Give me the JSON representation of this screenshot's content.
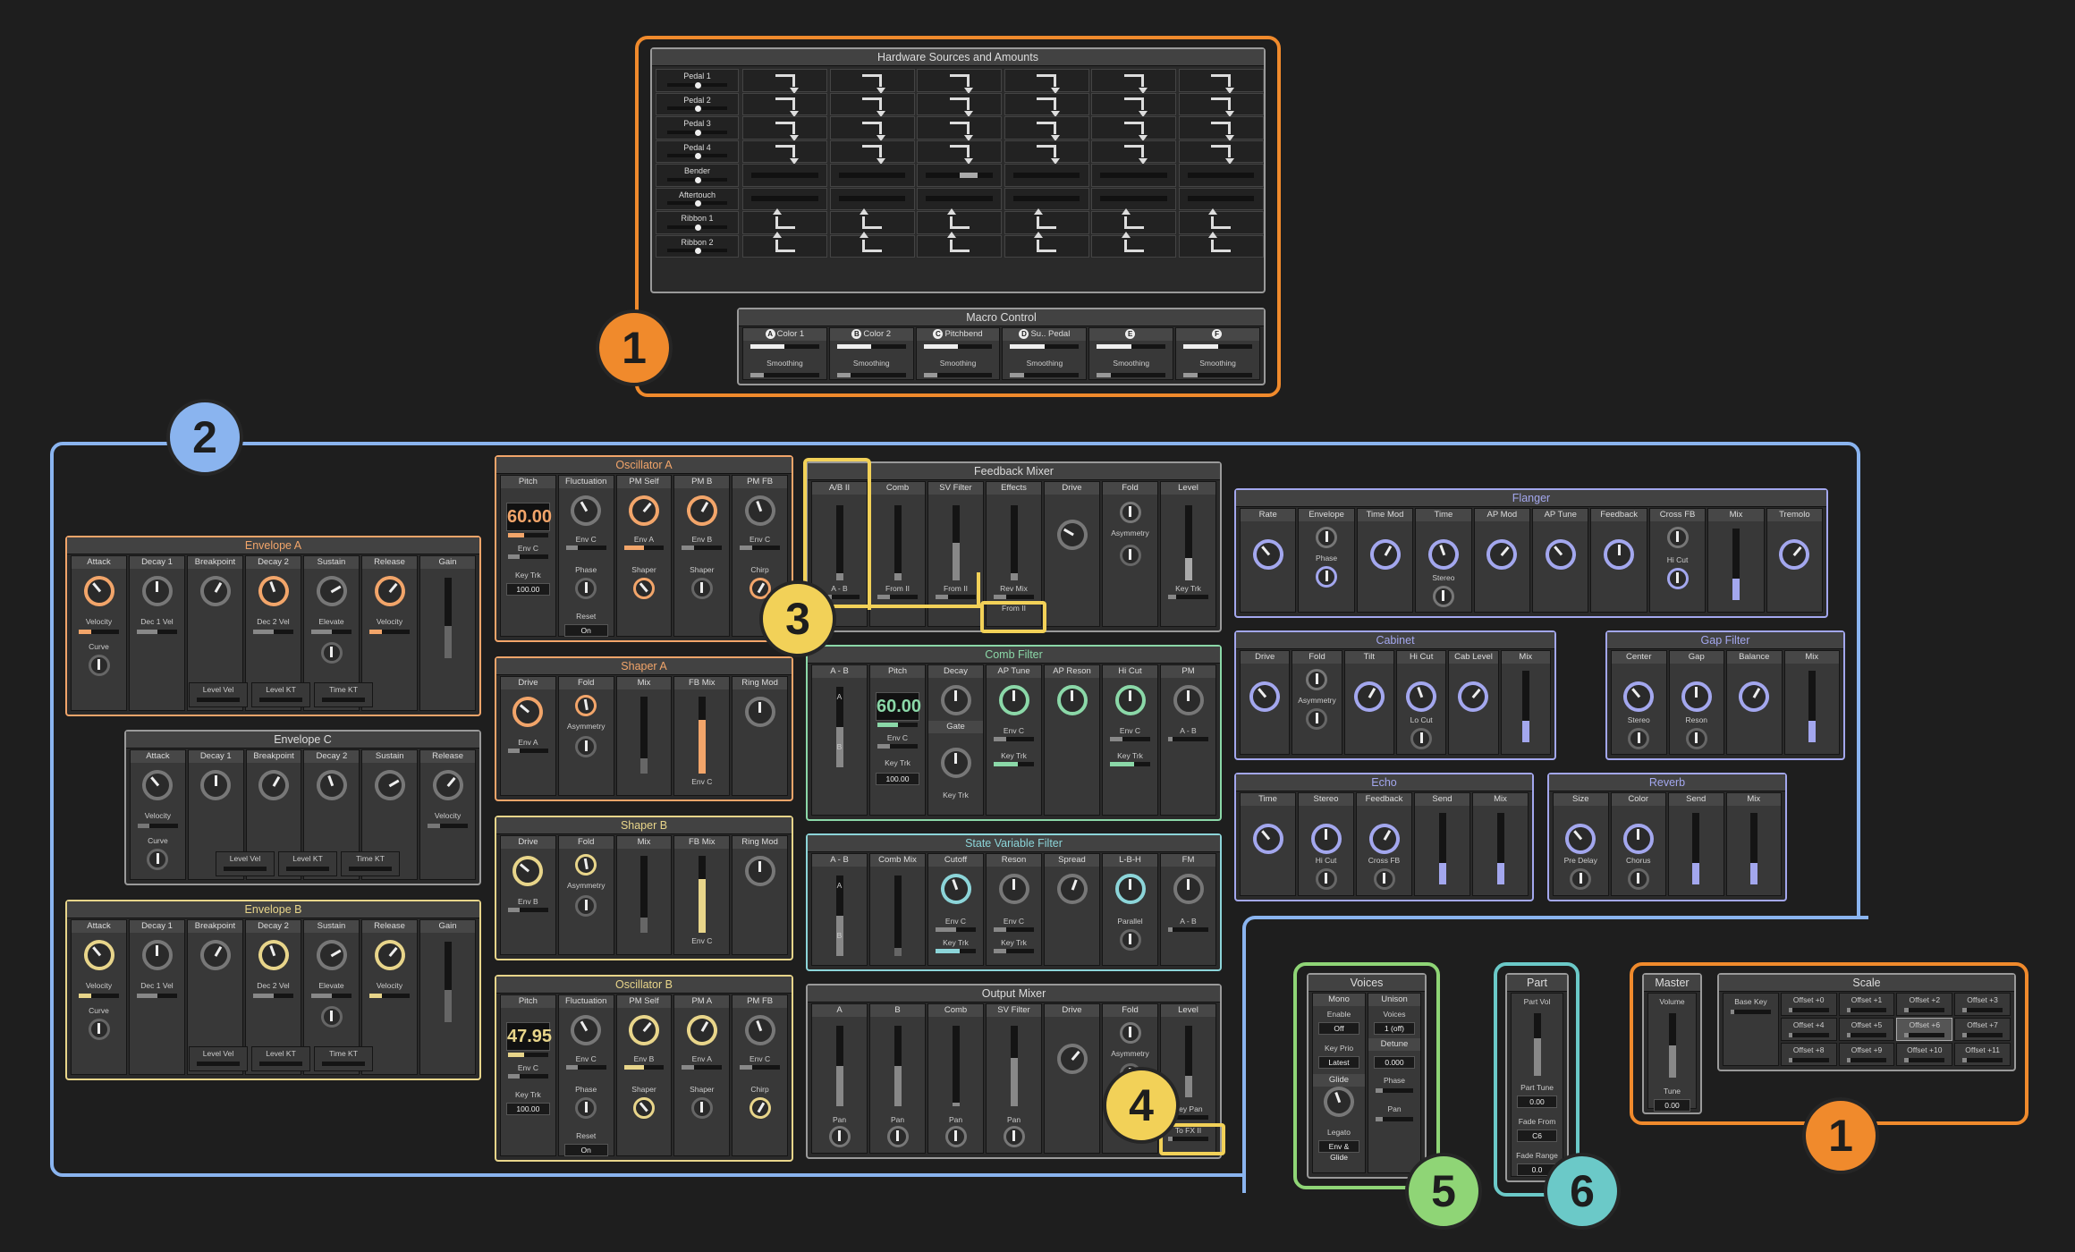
{
  "colors": {
    "orange": "#f08a2c",
    "blue": "#8ab4ef",
    "yellow": "#f2d158",
    "green": "#8fd576",
    "teal": "#6bc9c8",
    "env_a": "#f2a56a",
    "env_b": "#e8d58a",
    "comb": "#8bd8a8",
    "svf": "#8cd5d9",
    "fx": "#a3a7ee"
  },
  "badges": [
    "1",
    "2",
    "3",
    "4",
    "5",
    "1",
    "6"
  ],
  "hardware": {
    "title": "Hardware Sources and Amounts",
    "rows": [
      "Pedal 1",
      "Pedal 2",
      "Pedal 3",
      "Pedal 4",
      "Bender",
      "Aftertouch",
      "Ribbon 1",
      "Ribbon 2"
    ]
  },
  "macro": {
    "title": "Macro Control",
    "controls": [
      {
        "letter": "A",
        "name": "Color 1"
      },
      {
        "letter": "B",
        "name": "Color 2"
      },
      {
        "letter": "C",
        "name": "Pitchbend"
      },
      {
        "letter": "D",
        "name": "Su.. Pedal"
      },
      {
        "letter": "E",
        "name": ""
      },
      {
        "letter": "F",
        "name": ""
      }
    ],
    "smoothing": "Smoothing"
  },
  "env_a": {
    "title": "Envelope A",
    "cols": [
      "Attack",
      "Decay 1",
      "Breakpoint",
      "Decay 2",
      "Sustain",
      "Release",
      "Gain"
    ],
    "subs": [
      "Velocity",
      "Dec 1 Vel",
      "",
      "Dec 2 Vel",
      "Elevate",
      "Velocity"
    ],
    "curve": "Curve",
    "bottom": [
      "Level Vel",
      "Level KT",
      "Time KT"
    ]
  },
  "env_c": {
    "title": "Envelope C",
    "cols": [
      "Attack",
      "Decay 1",
      "Breakpoint",
      "Decay 2",
      "Sustain",
      "Release"
    ],
    "subs": [
      "Velocity",
      "",
      "",
      "",
      "",
      "Velocity"
    ],
    "curve": "Curve",
    "bottom": [
      "Level Vel",
      "Level KT",
      "Time KT"
    ]
  },
  "env_b": {
    "title": "Envelope B",
    "cols": [
      "Attack",
      "Decay 1",
      "Breakpoint",
      "Decay 2",
      "Sustain",
      "Release",
      "Gain"
    ],
    "subs": [
      "Velocity",
      "Dec 1 Vel",
      "",
      "Dec 2 Vel",
      "Elevate",
      "Velocity"
    ],
    "curve": "Curve",
    "bottom": [
      "Level Vel",
      "Level KT",
      "Time KT"
    ]
  },
  "osc_a": {
    "title": "Oscillator A",
    "cols": [
      "Pitch",
      "Fluctuation",
      "PM Self",
      "PM B",
      "PM FB"
    ],
    "pitch": "60.00",
    "subs": [
      "Env C",
      "Env C",
      "Env A",
      "Env B",
      "Env C"
    ],
    "keytrk": "Key Trk",
    "keytrk_val": "100.00",
    "phase": "Phase",
    "shaper": "Shaper",
    "chirp": "Chirp",
    "reset": "Reset",
    "reset_val": "On"
  },
  "shaper_a": {
    "title": "Shaper A",
    "cols": [
      "Drive",
      "Fold",
      "Mix",
      "FB Mix",
      "Ring Mod"
    ],
    "env": "Env A",
    "asym": "Asymmetry",
    "envc": "Env C"
  },
  "shaper_b": {
    "title": "Shaper B",
    "cols": [
      "Drive",
      "Fold",
      "Mix",
      "FB Mix",
      "Ring Mod"
    ],
    "env": "Env B",
    "asym": "Asymmetry",
    "envc": "Env C"
  },
  "osc_b": {
    "title": "Oscillator B",
    "cols": [
      "Pitch",
      "Fluctuation",
      "PM Self",
      "PM A",
      "PM FB"
    ],
    "pitch": "47.95",
    "subs": [
      "Env C",
      "Env C",
      "Env B",
      "Env A",
      "Env C"
    ],
    "keytrk": "Key Trk",
    "keytrk_val": "100.00",
    "phase": "Phase",
    "shaper": "Shaper",
    "chirp": "Chirp",
    "reset": "Reset",
    "reset_val": "On"
  },
  "fb_mixer": {
    "title": "Feedback Mixer",
    "cols": [
      "A/B II",
      "Comb",
      "SV Filter",
      "Effects",
      "Drive",
      "Fold",
      "Level"
    ],
    "subs": [
      "A - B",
      "From II",
      "From II",
      "Rev Mix"
    ],
    "from2": "From II",
    "asym": "Asymmetry",
    "keytrk": "Key Trk"
  },
  "comb": {
    "title": "Comb Filter",
    "cols": [
      "A - B",
      "Pitch",
      "Decay",
      "AP Tune",
      "AP Reson",
      "Hi Cut",
      "PM"
    ],
    "pitch": "60.00",
    "envc": "Env C",
    "keytrk": "Key Trk",
    "keytrk_val": "100.00",
    "gate": "Gate",
    "ab": "A - B",
    "a": "A",
    "b": "B"
  },
  "svf": {
    "title": "State Variable Filter",
    "cols": [
      "A - B",
      "Comb Mix",
      "Cutoff",
      "Reson",
      "Spread",
      "L-B-H",
      "FM"
    ],
    "envc": "Env C",
    "keytrk": "Key Trk",
    "parallel": "Parallel",
    "ab": "A - B",
    "a": "A",
    "b": "B"
  },
  "out_mixer": {
    "title": "Output Mixer",
    "cols": [
      "A",
      "B",
      "Comb",
      "SV Filter",
      "Drive",
      "Fold",
      "Level"
    ],
    "pan": "Pan",
    "asym": "Asymmetry",
    "keypan": "Key Pan",
    "tofx": "To FX II"
  },
  "flanger": {
    "title": "Flanger",
    "cols": [
      "Rate",
      "Envelope",
      "Time Mod",
      "Time",
      "AP Mod",
      "AP Tune",
      "Feedback",
      "Cross FB",
      "Mix",
      "Tremolo"
    ],
    "phase": "Phase",
    "stereo": "Stereo",
    "hicut": "Hi Cut"
  },
  "cabinet": {
    "title": "Cabinet",
    "cols": [
      "Drive",
      "Fold",
      "Tilt",
      "Hi Cut",
      "Cab Level",
      "Mix"
    ],
    "asym": "Asymmetry",
    "locut": "Lo Cut"
  },
  "gap": {
    "title": "Gap Filter",
    "cols": [
      "Center",
      "Gap",
      "Balance",
      "Mix"
    ],
    "stereo": "Stereo",
    "reson": "Reson"
  },
  "echo": {
    "title": "Echo",
    "cols": [
      "Time",
      "Stereo",
      "Feedback",
      "Send",
      "Mix"
    ],
    "hicut": "Hi Cut",
    "crossfb": "Cross FB"
  },
  "reverb": {
    "title": "Reverb",
    "cols": [
      "Size",
      "Color",
      "Send",
      "Mix"
    ],
    "predelay": "Pre Delay",
    "chorus": "Chorus"
  },
  "voices": {
    "title": "Voices",
    "mono": "Mono",
    "unison": "Unison",
    "enable": "Enable",
    "enable_val": "Off",
    "voices": "Voices",
    "voices_val": "1 (off)",
    "keyprio": "Key Prio",
    "keyprio_val": "Latest",
    "detune": "Detune",
    "detune_val": "0.000",
    "glide": "Glide",
    "phase": "Phase",
    "pan": "Pan",
    "legato": "Legato",
    "legato_val": "Env & Glide"
  },
  "part": {
    "title": "Part",
    "partvol": "Part Vol",
    "parttune": "Part Tune",
    "parttune_val": "0.00",
    "fadefrom": "Fade From",
    "fadefrom_val": "C6",
    "faderange": "Fade Range",
    "faderange_val": "0.0"
  },
  "master": {
    "title": "Master",
    "volume": "Volume",
    "tune": "Tune",
    "tune_val": "0.00"
  },
  "scale": {
    "title": "Scale",
    "basekey": "Base Key",
    "offsets": [
      "Offset +0",
      "Offset +1",
      "Offset +2",
      "Offset +3",
      "Offset +4",
      "Offset +5",
      "Offset +6",
      "Offset +7",
      "Offset +8",
      "Offset +9",
      "Offset +10",
      "Offset +11"
    ]
  }
}
